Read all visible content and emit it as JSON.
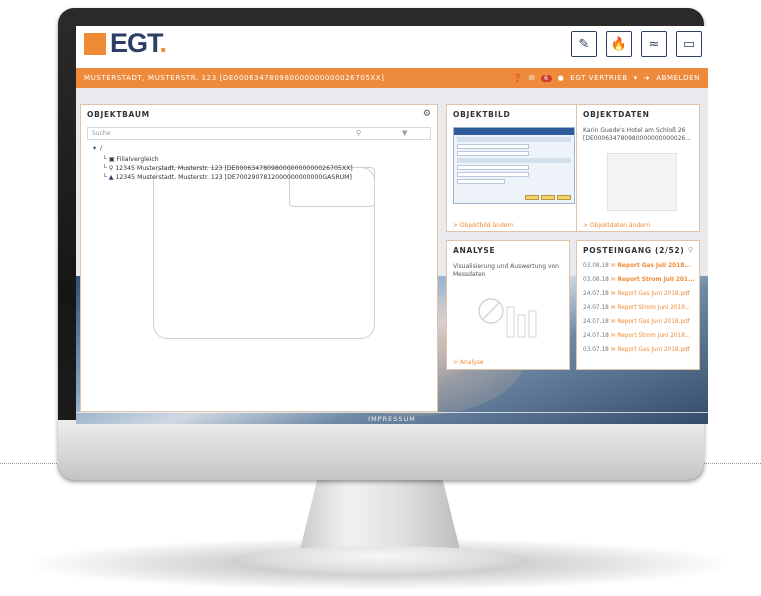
{
  "brand": {
    "name": "EGT",
    "dot": ".",
    "accent": "#f08a34",
    "navy": "#2c3e63"
  },
  "top_icons": [
    "document-icon",
    "flame-icon",
    "waves-icon",
    "radiator-icon"
  ],
  "header_bar": {
    "address": "MUSTERSTADT, MUSTERSTR. 123 [DE000634780980000000000026705XX]",
    "notifications": "6",
    "user": "EGT VERTRIEB",
    "logout": "ABMELDEN"
  },
  "objektbaum": {
    "title": "OBJEKTBAUM",
    "search_placeholder": "Suche",
    "root": "/",
    "items": [
      "Filialvergleich",
      "12345 Musterstadt, Musterstr. 123 [DE000634780980000000000026705XX]",
      "12345 Musterstadt, Musterstr. 123 [DE7002907812000000000000GASRUM]"
    ]
  },
  "objektbild": {
    "title": "OBJEKTBILD",
    "link": "> Objektbild ändern"
  },
  "objektdaten": {
    "title": "OBJEKTDATEN",
    "line1": "Karin Guede's Hotel am Schloß 26",
    "line2": "[DE000634780980000000000026...",
    "link": "> Objektdaten ändern"
  },
  "analyse": {
    "title": "ANALYSE",
    "text1": "Visualisierung und Auswertung von",
    "text2": "Messdaten",
    "link": "> Analyse"
  },
  "posteingang": {
    "title": "POSTEINGANG (2/52)",
    "items": [
      {
        "date": "03.08.18",
        "label": "Report Gas Juli 2018...",
        "bold": true
      },
      {
        "date": "03.08.18",
        "label": "Report Strom Juli 201...",
        "bold": true
      },
      {
        "date": "24.07.18",
        "label": "Report Gas Juni 2018.pdf",
        "bold": false
      },
      {
        "date": "24.07.18",
        "label": "Report Strom Juni 2018...",
        "bold": false
      },
      {
        "date": "24.07.18",
        "label": "Report Gas Juni 2018.pdf",
        "bold": false
      },
      {
        "date": "24.07.18",
        "label": "Report Strom Juni 2018...",
        "bold": false
      },
      {
        "date": "03.07.18",
        "label": "Report Gas Juni 2018.pdf",
        "bold": false
      }
    ]
  },
  "footer": {
    "label": "IMPRESSUM"
  }
}
